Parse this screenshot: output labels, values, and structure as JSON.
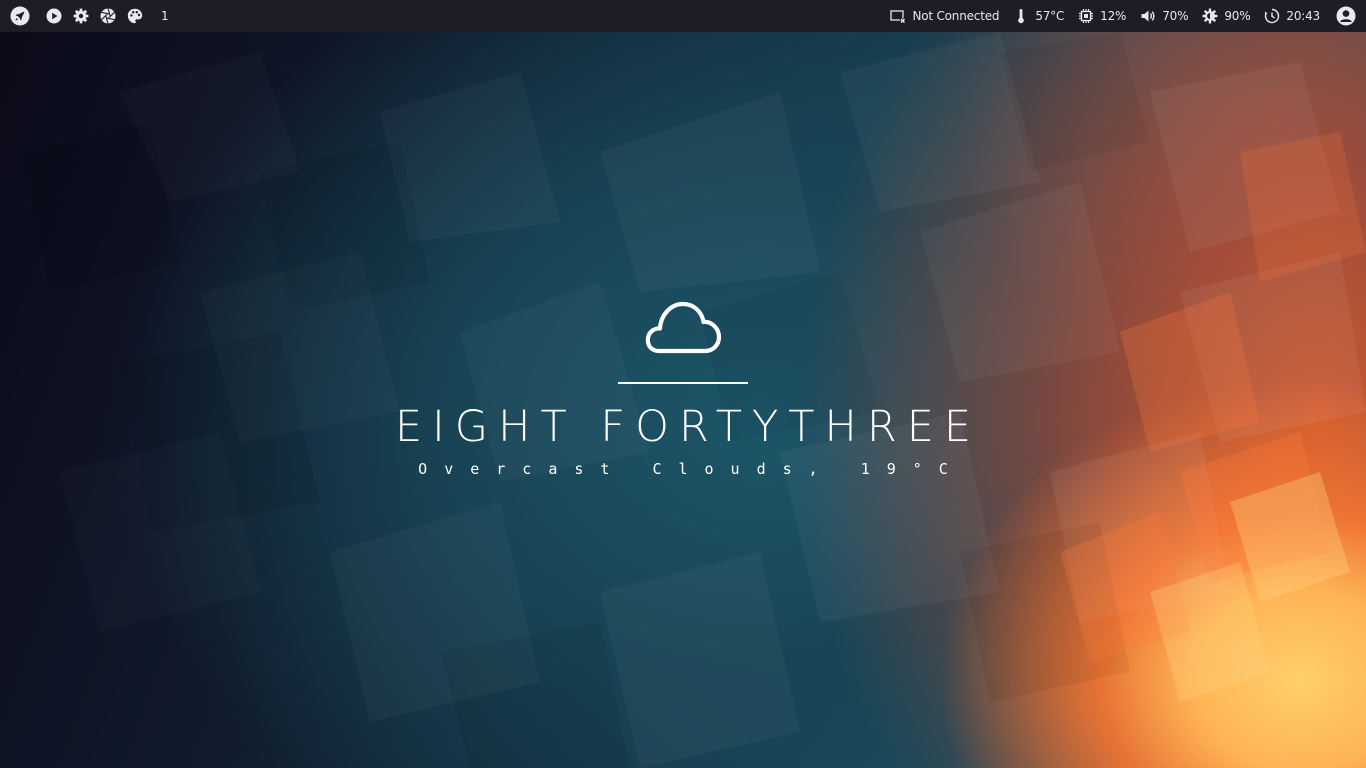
{
  "topbar": {
    "workspace_number": "1",
    "left_icons": [
      "rocket-icon",
      "play-icon",
      "gear-icon",
      "aperture-icon",
      "palette-icon"
    ],
    "network_label": "Not Connected",
    "temperature": "57°C",
    "cpu": "12%",
    "volume": "70%",
    "brightness": "90%",
    "clock": "20:43",
    "right_icons": [
      "network-disconnected-icon",
      "thermometer-icon",
      "cpu-icon",
      "volume-icon",
      "brightness-icon",
      "clock-icon",
      "user-avatar-icon"
    ]
  },
  "desktop": {
    "weather_icon": "cloud-icon",
    "time_words": "EIGHT FORTYTHREE",
    "weather_text": "Overcast Clouds, 19°C"
  },
  "colors": {
    "bar_background": "#1e1d25",
    "bar_text": "#e8e8ee",
    "widget_text": "#ffffff"
  }
}
